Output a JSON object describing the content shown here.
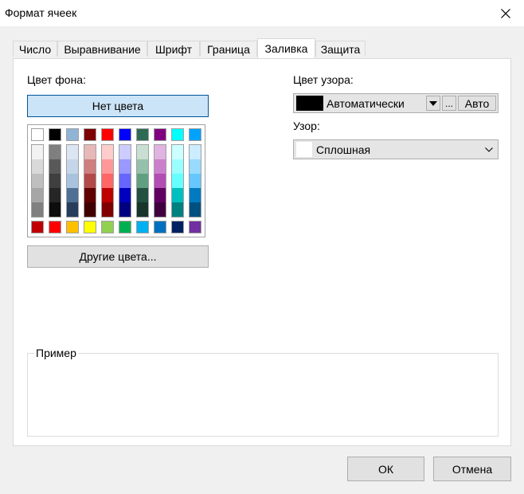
{
  "window": {
    "title": "Формат ячеек"
  },
  "tabs": [
    {
      "label": "Число"
    },
    {
      "label": "Выравнивание"
    },
    {
      "label": "Шрифт"
    },
    {
      "label": "Граница"
    },
    {
      "label": "Заливка"
    },
    {
      "label": "Защита"
    }
  ],
  "fill": {
    "bg_color_label": "Цвет фона:",
    "no_color_label": "Нет цвета",
    "other_colors_label": "Другие цвета...",
    "pattern_color_label": "Цвет узора:",
    "pattern_color_value": "Автоматически",
    "pattern_color_swatch": "#000000",
    "ellipsis_label": "...",
    "auto_label": "Авто",
    "pattern_label": "Узор:",
    "pattern_value": "Сплошная",
    "pattern_swatch": "#ffffff",
    "sample_label": "Пример",
    "palette": {
      "top": [
        "#ffffff",
        "#000000",
        "#8fb4d6",
        "#7f0000",
        "#ff0000",
        "#0000ff",
        "#2e6b55",
        "#800080",
        "#00ffff",
        "#00a2ff"
      ],
      "shades": [
        [
          "#f2f2f2",
          "#d9d9d9",
          "#bfbfbf",
          "#a6a6a6",
          "#808080"
        ],
        [
          "#7f7f7f",
          "#595959",
          "#3f3f3f",
          "#262626",
          "#0d0d0d"
        ],
        [
          "#dce6f2",
          "#c5d6ea",
          "#a9c3df",
          "#4f6f94",
          "#263e5c"
        ],
        [
          "#e6b9b8",
          "#cf7f7e",
          "#b24a49",
          "#600000",
          "#400000"
        ],
        [
          "#ffcccc",
          "#ff9999",
          "#ff6666",
          "#bf0000",
          "#800000"
        ],
        [
          "#ccccff",
          "#9999ff",
          "#6666ff",
          "#0000bf",
          "#000080"
        ],
        [
          "#c9dfd4",
          "#95c0ab",
          "#60a080",
          "#245041",
          "#17352b"
        ],
        [
          "#e0b3e0",
          "#cc80cc",
          "#b34db3",
          "#600060",
          "#400040"
        ],
        [
          "#ccffff",
          "#99ffff",
          "#66ffff",
          "#00bfbf",
          "#008080"
        ],
        [
          "#ccecff",
          "#99daff",
          "#66c7ff",
          "#007ac0",
          "#005180"
        ]
      ],
      "standard": [
        "#c00000",
        "#ff0000",
        "#ffc000",
        "#ffff00",
        "#92d050",
        "#00b050",
        "#00b0f0",
        "#0070c0",
        "#002060",
        "#7030a0"
      ]
    }
  },
  "footer": {
    "ok_label": "ОК",
    "cancel_label": "Отмена"
  }
}
